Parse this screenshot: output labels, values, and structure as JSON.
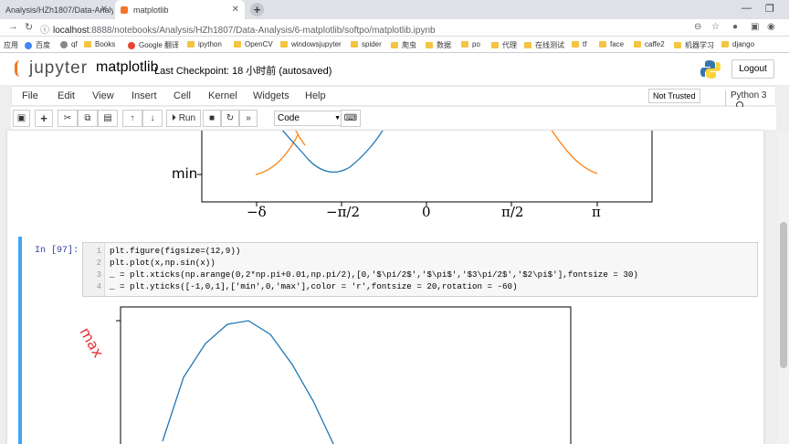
{
  "browser": {
    "tabs": [
      {
        "label": "Analysis/HZh1807/Data-Analy"
      },
      {
        "label": "matplotlib"
      }
    ],
    "new_tab_label": "+",
    "url_host": "localhost",
    "url_rest": ":8888/notebooks/Analysis/HZh1807/Data-Analysis/6-matplotlib/softpo/matplotlib.ipynb",
    "bookmarks": [
      "应用",
      "百度",
      "qf",
      "Books",
      "Google 翻译",
      "ipython",
      "OpenCV",
      "windowsjupyter",
      "spider",
      "爬虫",
      "数据",
      "po",
      "代理",
      "在线测试",
      "tf",
      "face",
      "caffe2",
      "机器学习",
      "django"
    ]
  },
  "jupyter": {
    "logo_text": "jupyter",
    "notebook_name": "matplotlib",
    "checkpoint": "Last Checkpoint: 18 小时前   (autosaved)",
    "logout": "Logout",
    "menu": [
      "File",
      "Edit",
      "View",
      "Insert",
      "Cell",
      "Kernel",
      "Widgets",
      "Help"
    ],
    "not_trusted": "Not Trusted",
    "kernel_name": "Python 3",
    "run_label": "Run",
    "cell_type": "Code"
  },
  "cell": {
    "prompt": "In  [97]:",
    "lines": [
      "plt.figure(figsize=(12,9))",
      "plt.plot(x,np.sin(x))",
      "_ = plt.xticks(np.arange(0,2*np.pi+0.01,np.pi/2),[0,'$\\pi/2$','$\\pi$','$3\\pi/2$','$2\\pi$'],fontsize = 30)",
      "_ = plt.yticks([-1,0,1],['min',0,'max'],color = 'r',fontsize = 20,rotation = -60)"
    ],
    "line_numbers": [
      "1",
      "2",
      "3",
      "4"
    ]
  },
  "prev_output": {
    "ytick": "min",
    "xticks": [
      "−δ",
      "−π/2",
      "0",
      "π/2",
      "π"
    ]
  },
  "new_output": {
    "ytick": "max"
  },
  "colors": {
    "blue_line": "#1f77b4",
    "orange_line": "#ff7f0e",
    "cell_selected": "#42a5f5",
    "red_tick": "#e8313a"
  }
}
